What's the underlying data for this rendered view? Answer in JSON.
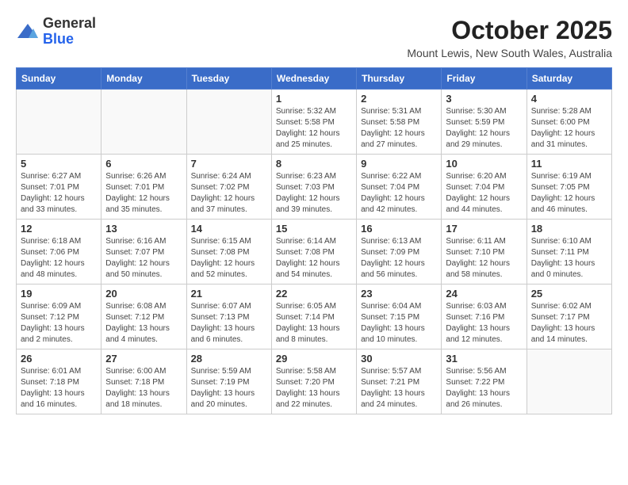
{
  "header": {
    "logo_general": "General",
    "logo_blue": "Blue",
    "month_year": "October 2025",
    "location": "Mount Lewis, New South Wales, Australia"
  },
  "weekdays": [
    "Sunday",
    "Monday",
    "Tuesday",
    "Wednesday",
    "Thursday",
    "Friday",
    "Saturday"
  ],
  "weeks": [
    [
      {
        "day": "",
        "info": ""
      },
      {
        "day": "",
        "info": ""
      },
      {
        "day": "",
        "info": ""
      },
      {
        "day": "1",
        "info": "Sunrise: 5:32 AM\nSunset: 5:58 PM\nDaylight: 12 hours\nand 25 minutes."
      },
      {
        "day": "2",
        "info": "Sunrise: 5:31 AM\nSunset: 5:58 PM\nDaylight: 12 hours\nand 27 minutes."
      },
      {
        "day": "3",
        "info": "Sunrise: 5:30 AM\nSunset: 5:59 PM\nDaylight: 12 hours\nand 29 minutes."
      },
      {
        "day": "4",
        "info": "Sunrise: 5:28 AM\nSunset: 6:00 PM\nDaylight: 12 hours\nand 31 minutes."
      }
    ],
    [
      {
        "day": "5",
        "info": "Sunrise: 6:27 AM\nSunset: 7:01 PM\nDaylight: 12 hours\nand 33 minutes."
      },
      {
        "day": "6",
        "info": "Sunrise: 6:26 AM\nSunset: 7:01 PM\nDaylight: 12 hours\nand 35 minutes."
      },
      {
        "day": "7",
        "info": "Sunrise: 6:24 AM\nSunset: 7:02 PM\nDaylight: 12 hours\nand 37 minutes."
      },
      {
        "day": "8",
        "info": "Sunrise: 6:23 AM\nSunset: 7:03 PM\nDaylight: 12 hours\nand 39 minutes."
      },
      {
        "day": "9",
        "info": "Sunrise: 6:22 AM\nSunset: 7:04 PM\nDaylight: 12 hours\nand 42 minutes."
      },
      {
        "day": "10",
        "info": "Sunrise: 6:20 AM\nSunset: 7:04 PM\nDaylight: 12 hours\nand 44 minutes."
      },
      {
        "day": "11",
        "info": "Sunrise: 6:19 AM\nSunset: 7:05 PM\nDaylight: 12 hours\nand 46 minutes."
      }
    ],
    [
      {
        "day": "12",
        "info": "Sunrise: 6:18 AM\nSunset: 7:06 PM\nDaylight: 12 hours\nand 48 minutes."
      },
      {
        "day": "13",
        "info": "Sunrise: 6:16 AM\nSunset: 7:07 PM\nDaylight: 12 hours\nand 50 minutes."
      },
      {
        "day": "14",
        "info": "Sunrise: 6:15 AM\nSunset: 7:08 PM\nDaylight: 12 hours\nand 52 minutes."
      },
      {
        "day": "15",
        "info": "Sunrise: 6:14 AM\nSunset: 7:08 PM\nDaylight: 12 hours\nand 54 minutes."
      },
      {
        "day": "16",
        "info": "Sunrise: 6:13 AM\nSunset: 7:09 PM\nDaylight: 12 hours\nand 56 minutes."
      },
      {
        "day": "17",
        "info": "Sunrise: 6:11 AM\nSunset: 7:10 PM\nDaylight: 12 hours\nand 58 minutes."
      },
      {
        "day": "18",
        "info": "Sunrise: 6:10 AM\nSunset: 7:11 PM\nDaylight: 13 hours\nand 0 minutes."
      }
    ],
    [
      {
        "day": "19",
        "info": "Sunrise: 6:09 AM\nSunset: 7:12 PM\nDaylight: 13 hours\nand 2 minutes."
      },
      {
        "day": "20",
        "info": "Sunrise: 6:08 AM\nSunset: 7:12 PM\nDaylight: 13 hours\nand 4 minutes."
      },
      {
        "day": "21",
        "info": "Sunrise: 6:07 AM\nSunset: 7:13 PM\nDaylight: 13 hours\nand 6 minutes."
      },
      {
        "day": "22",
        "info": "Sunrise: 6:05 AM\nSunset: 7:14 PM\nDaylight: 13 hours\nand 8 minutes."
      },
      {
        "day": "23",
        "info": "Sunrise: 6:04 AM\nSunset: 7:15 PM\nDaylight: 13 hours\nand 10 minutes."
      },
      {
        "day": "24",
        "info": "Sunrise: 6:03 AM\nSunset: 7:16 PM\nDaylight: 13 hours\nand 12 minutes."
      },
      {
        "day": "25",
        "info": "Sunrise: 6:02 AM\nSunset: 7:17 PM\nDaylight: 13 hours\nand 14 minutes."
      }
    ],
    [
      {
        "day": "26",
        "info": "Sunrise: 6:01 AM\nSunset: 7:18 PM\nDaylight: 13 hours\nand 16 minutes."
      },
      {
        "day": "27",
        "info": "Sunrise: 6:00 AM\nSunset: 7:18 PM\nDaylight: 13 hours\nand 18 minutes."
      },
      {
        "day": "28",
        "info": "Sunrise: 5:59 AM\nSunset: 7:19 PM\nDaylight: 13 hours\nand 20 minutes."
      },
      {
        "day": "29",
        "info": "Sunrise: 5:58 AM\nSunset: 7:20 PM\nDaylight: 13 hours\nand 22 minutes."
      },
      {
        "day": "30",
        "info": "Sunrise: 5:57 AM\nSunset: 7:21 PM\nDaylight: 13 hours\nand 24 minutes."
      },
      {
        "day": "31",
        "info": "Sunrise: 5:56 AM\nSunset: 7:22 PM\nDaylight: 13 hours\nand 26 minutes."
      },
      {
        "day": "",
        "info": ""
      }
    ]
  ]
}
